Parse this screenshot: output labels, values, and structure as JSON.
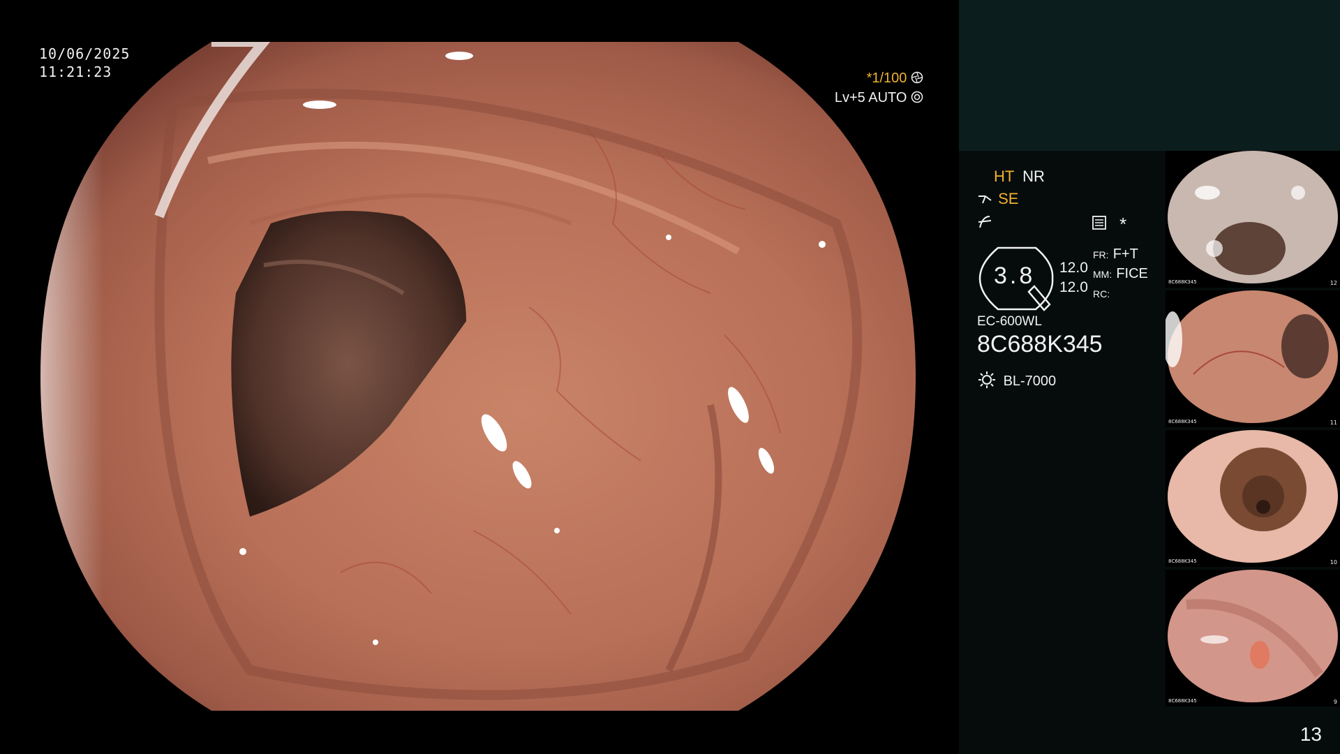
{
  "main": {
    "date": "10/06/2025",
    "time": "11:21:23",
    "shutter": "*1/100",
    "level": "Lv+5",
    "iris": "AUTO"
  },
  "panel": {
    "ht": "HT",
    "nr": "NR",
    "se": "SE",
    "zoom": "3.8",
    "val1": "12.0",
    "val2": "12.0",
    "fr_label": "FR:",
    "fr_value": "F+T",
    "mm_label": "MM:",
    "mm_value": "FICE",
    "rc_label": "RC:",
    "scope_model": "EC-600WL",
    "serial": "8C688K345",
    "light_source": "BL-7000",
    "star": "*"
  },
  "thumbnails": [
    {
      "serial": "8C688K345",
      "index": "12"
    },
    {
      "serial": "8C688K345",
      "index": "11"
    },
    {
      "serial": "8C688K345",
      "index": "10"
    },
    {
      "serial": "8C688K345",
      "index": "9"
    }
  ],
  "page_number": "13",
  "colors": {
    "accent": "#f0b232",
    "panel_top": "#0c1d1d",
    "panel": "#060c0c"
  }
}
